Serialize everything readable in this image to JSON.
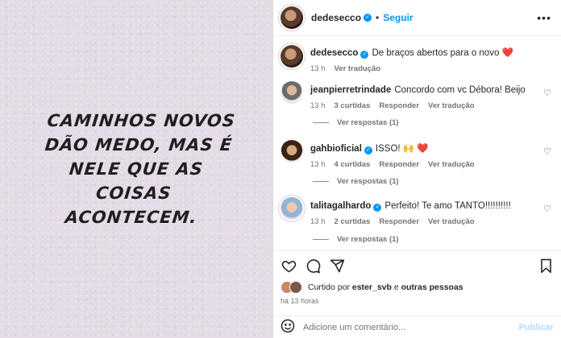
{
  "post": {
    "quote_lines": [
      "Caminhos novos",
      "dão medo, mas é",
      "nele que as coisas",
      "acontecem."
    ]
  },
  "header": {
    "username": "dedesecco",
    "verified": true,
    "dot": "•",
    "follow_label": "Seguir",
    "more_icon": "more-horizontal-icon"
  },
  "caption": {
    "username": "dedesecco",
    "text": "De braços abertos para o novo",
    "emoji": "❤️",
    "time": "13 h",
    "translate": "Ver tradução"
  },
  "comments": [
    {
      "username": "jeanpierretrindade",
      "verified": false,
      "text": "Concordo com vc Débora! Beijo",
      "time": "13 h",
      "likes": "3 curtidas",
      "reply": "Responder",
      "translate": "Ver tradução",
      "replies": "Ver respostas (1)"
    },
    {
      "username": "gahbioficial",
      "verified": true,
      "text": "ISSO! 🙌 ❤️",
      "time": "13 h",
      "likes": "4 curtidas",
      "reply": "Responder",
      "translate": "Ver tradução",
      "replies": "Ver respostas (1)"
    },
    {
      "username": "talitagalhardo",
      "verified": true,
      "text": "Perfeito! Te amo TANTO!!!!!!!!!!",
      "time": "13 h",
      "likes": "2 curtidas",
      "reply": "Responder",
      "translate": "Ver tradução",
      "replies": "Ver respostas (1)"
    }
  ],
  "actions": {
    "icons": [
      "heart-icon",
      "comment-icon",
      "share-icon",
      "bookmark-icon"
    ],
    "liked_prefix": "Curtido por",
    "liked_user": "ester_svb",
    "liked_connector": "e",
    "liked_others": "outras pessoas",
    "time_ago": "há 13 horas"
  },
  "add_comment": {
    "placeholder": "Adicione um comentário...",
    "publish_label": "Publicar"
  },
  "colors": {
    "accent": "#0095f6",
    "image_bg": "#e4dbe6",
    "heart": "#ed4956"
  }
}
